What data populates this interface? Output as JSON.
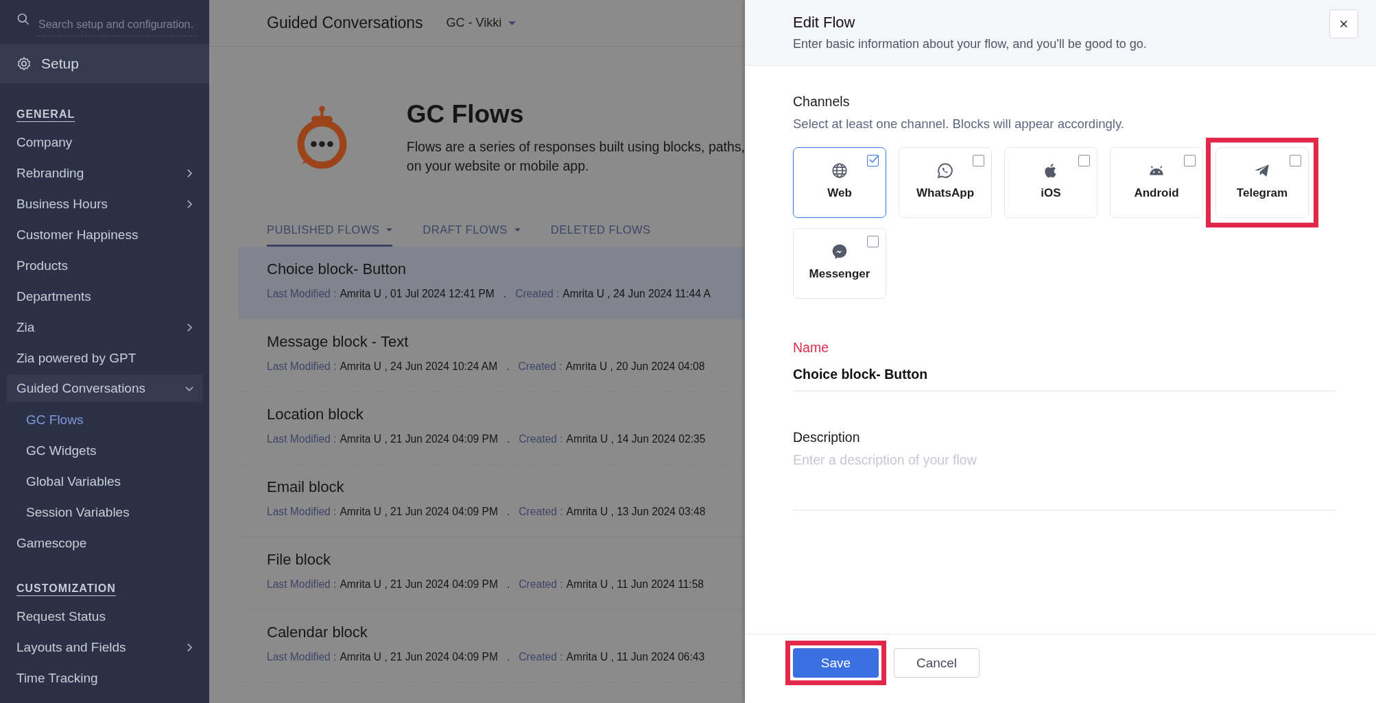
{
  "sidebar": {
    "search": {
      "placeholder": "Search setup and configuration.."
    },
    "header": "Setup",
    "sections": [
      {
        "title": "GENERAL",
        "items": [
          {
            "label": "Company",
            "submenu": false,
            "expanded": false
          },
          {
            "label": "Rebranding",
            "submenu": true,
            "expanded": false
          },
          {
            "label": "Business Hours",
            "submenu": true,
            "expanded": false
          },
          {
            "label": "Customer Happiness",
            "submenu": false,
            "expanded": false
          },
          {
            "label": "Products",
            "submenu": false,
            "expanded": false
          },
          {
            "label": "Departments",
            "submenu": false,
            "expanded": false
          },
          {
            "label": "Zia",
            "submenu": true,
            "expanded": false
          },
          {
            "label": "Zia powered by GPT",
            "submenu": false,
            "expanded": false
          },
          {
            "label": "Guided Conversations",
            "submenu": true,
            "expanded": true,
            "children": [
              {
                "label": "GC Flows",
                "selected": true
              },
              {
                "label": "GC Widgets",
                "selected": false
              },
              {
                "label": "Global Variables",
                "selected": false
              },
              {
                "label": "Session Variables",
                "selected": false
              }
            ]
          },
          {
            "label": "Gamescope",
            "submenu": false,
            "expanded": false
          }
        ]
      },
      {
        "title": "CUSTOMIZATION",
        "items": [
          {
            "label": "Request Status",
            "submenu": false,
            "expanded": false
          },
          {
            "label": "Layouts and Fields",
            "submenu": true,
            "expanded": false
          },
          {
            "label": "Time Tracking",
            "submenu": false,
            "expanded": false
          }
        ]
      }
    ]
  },
  "main": {
    "header": {
      "title": "Guided Conversations",
      "view": "GC - Vikki"
    },
    "hero": {
      "title": "GC Flows",
      "description": [
        "Flows are a series of responses built using blocks, paths,",
        "on your website or mobile app."
      ]
    },
    "tabs": [
      {
        "label": "PUBLISHED FLOWS",
        "selected": true,
        "dropdown": true
      },
      {
        "label": "DRAFT FLOWS",
        "selected": false,
        "dropdown": true
      },
      {
        "label": "DELETED FLOWS",
        "selected": false,
        "dropdown": false
      }
    ],
    "flows": [
      {
        "name": "Choice block- Button",
        "modified_label": "Last Modified :",
        "modified": "Amrita U , 01 Jul 2024 12:41 PM",
        "separator": ".",
        "created_label": "Created :",
        "created": "Amrita U , 24 Jun 2024 11:44 A",
        "selected": true
      },
      {
        "name": "Message block - Text",
        "modified_label": "Last Modified :",
        "modified": "Amrita U , 24 Jun 2024 10:24 AM",
        "separator": ".",
        "created_label": "Created :",
        "created": "Amrita U , 20 Jun 2024 04:08",
        "selected": false
      },
      {
        "name": "Location block",
        "modified_label": "Last Modified :",
        "modified": "Amrita U , 21 Jun 2024 04:09 PM",
        "created_label": "Created :",
        "separator": ".",
        "created": "Amrita U , 14 Jun 2024 02:35",
        "selected": false
      },
      {
        "name": "Email block",
        "modified_label": "Last Modified :",
        "modified": "Amrita U , 21 Jun 2024 04:09 PM",
        "created_label": "Created :",
        "separator": ".",
        "created": "Amrita U , 13 Jun 2024 03:48",
        "selected": false
      },
      {
        "name": "File block",
        "modified_label": "Last Modified :",
        "modified": "Amrita U , 21 Jun 2024 04:09 PM",
        "created_label": "Created :",
        "separator": ".",
        "created": "Amrita U , 11 Jun 2024 11:58",
        "selected": false
      },
      {
        "name": "Calendar block",
        "modified_label": "Last Modified :",
        "modified": "Amrita U , 21 Jun 2024 04:09 PM",
        "created_label": "Created :",
        "separator": ".",
        "created": "Amrita U , 11 Jun 2024 06:43",
        "selected": false
      }
    ]
  },
  "panel": {
    "title": "Edit Flow",
    "subtitle": "Enter basic information about your flow, and you'll be good to go.",
    "channels": {
      "label": "Channels",
      "hint": "Select at least one channel. Blocks will appear accordingly.",
      "items": [
        {
          "label": "Web",
          "kind": "web",
          "checked": true,
          "highlighted": false
        },
        {
          "label": "WhatsApp",
          "kind": "whatsapp",
          "checked": false,
          "highlighted": false
        },
        {
          "label": "iOS",
          "kind": "ios",
          "checked": false,
          "highlighted": false
        },
        {
          "label": "Android",
          "kind": "android",
          "checked": false,
          "highlighted": false
        },
        {
          "label": "Telegram",
          "kind": "telegram",
          "checked": false,
          "highlighted": true
        },
        {
          "label": "Messenger",
          "kind": "messenger",
          "checked": false,
          "highlighted": false
        }
      ]
    },
    "name": {
      "label": "Name",
      "required": true,
      "value": "Choice block- Button"
    },
    "description": {
      "label": "Description",
      "placeholder": "Enter a description of your flow"
    },
    "buttons": [
      {
        "label": "Save",
        "kind": "primary",
        "highlighted": true
      },
      {
        "label": "Cancel",
        "kind": "secondary",
        "highlighted": false
      }
    ]
  }
}
